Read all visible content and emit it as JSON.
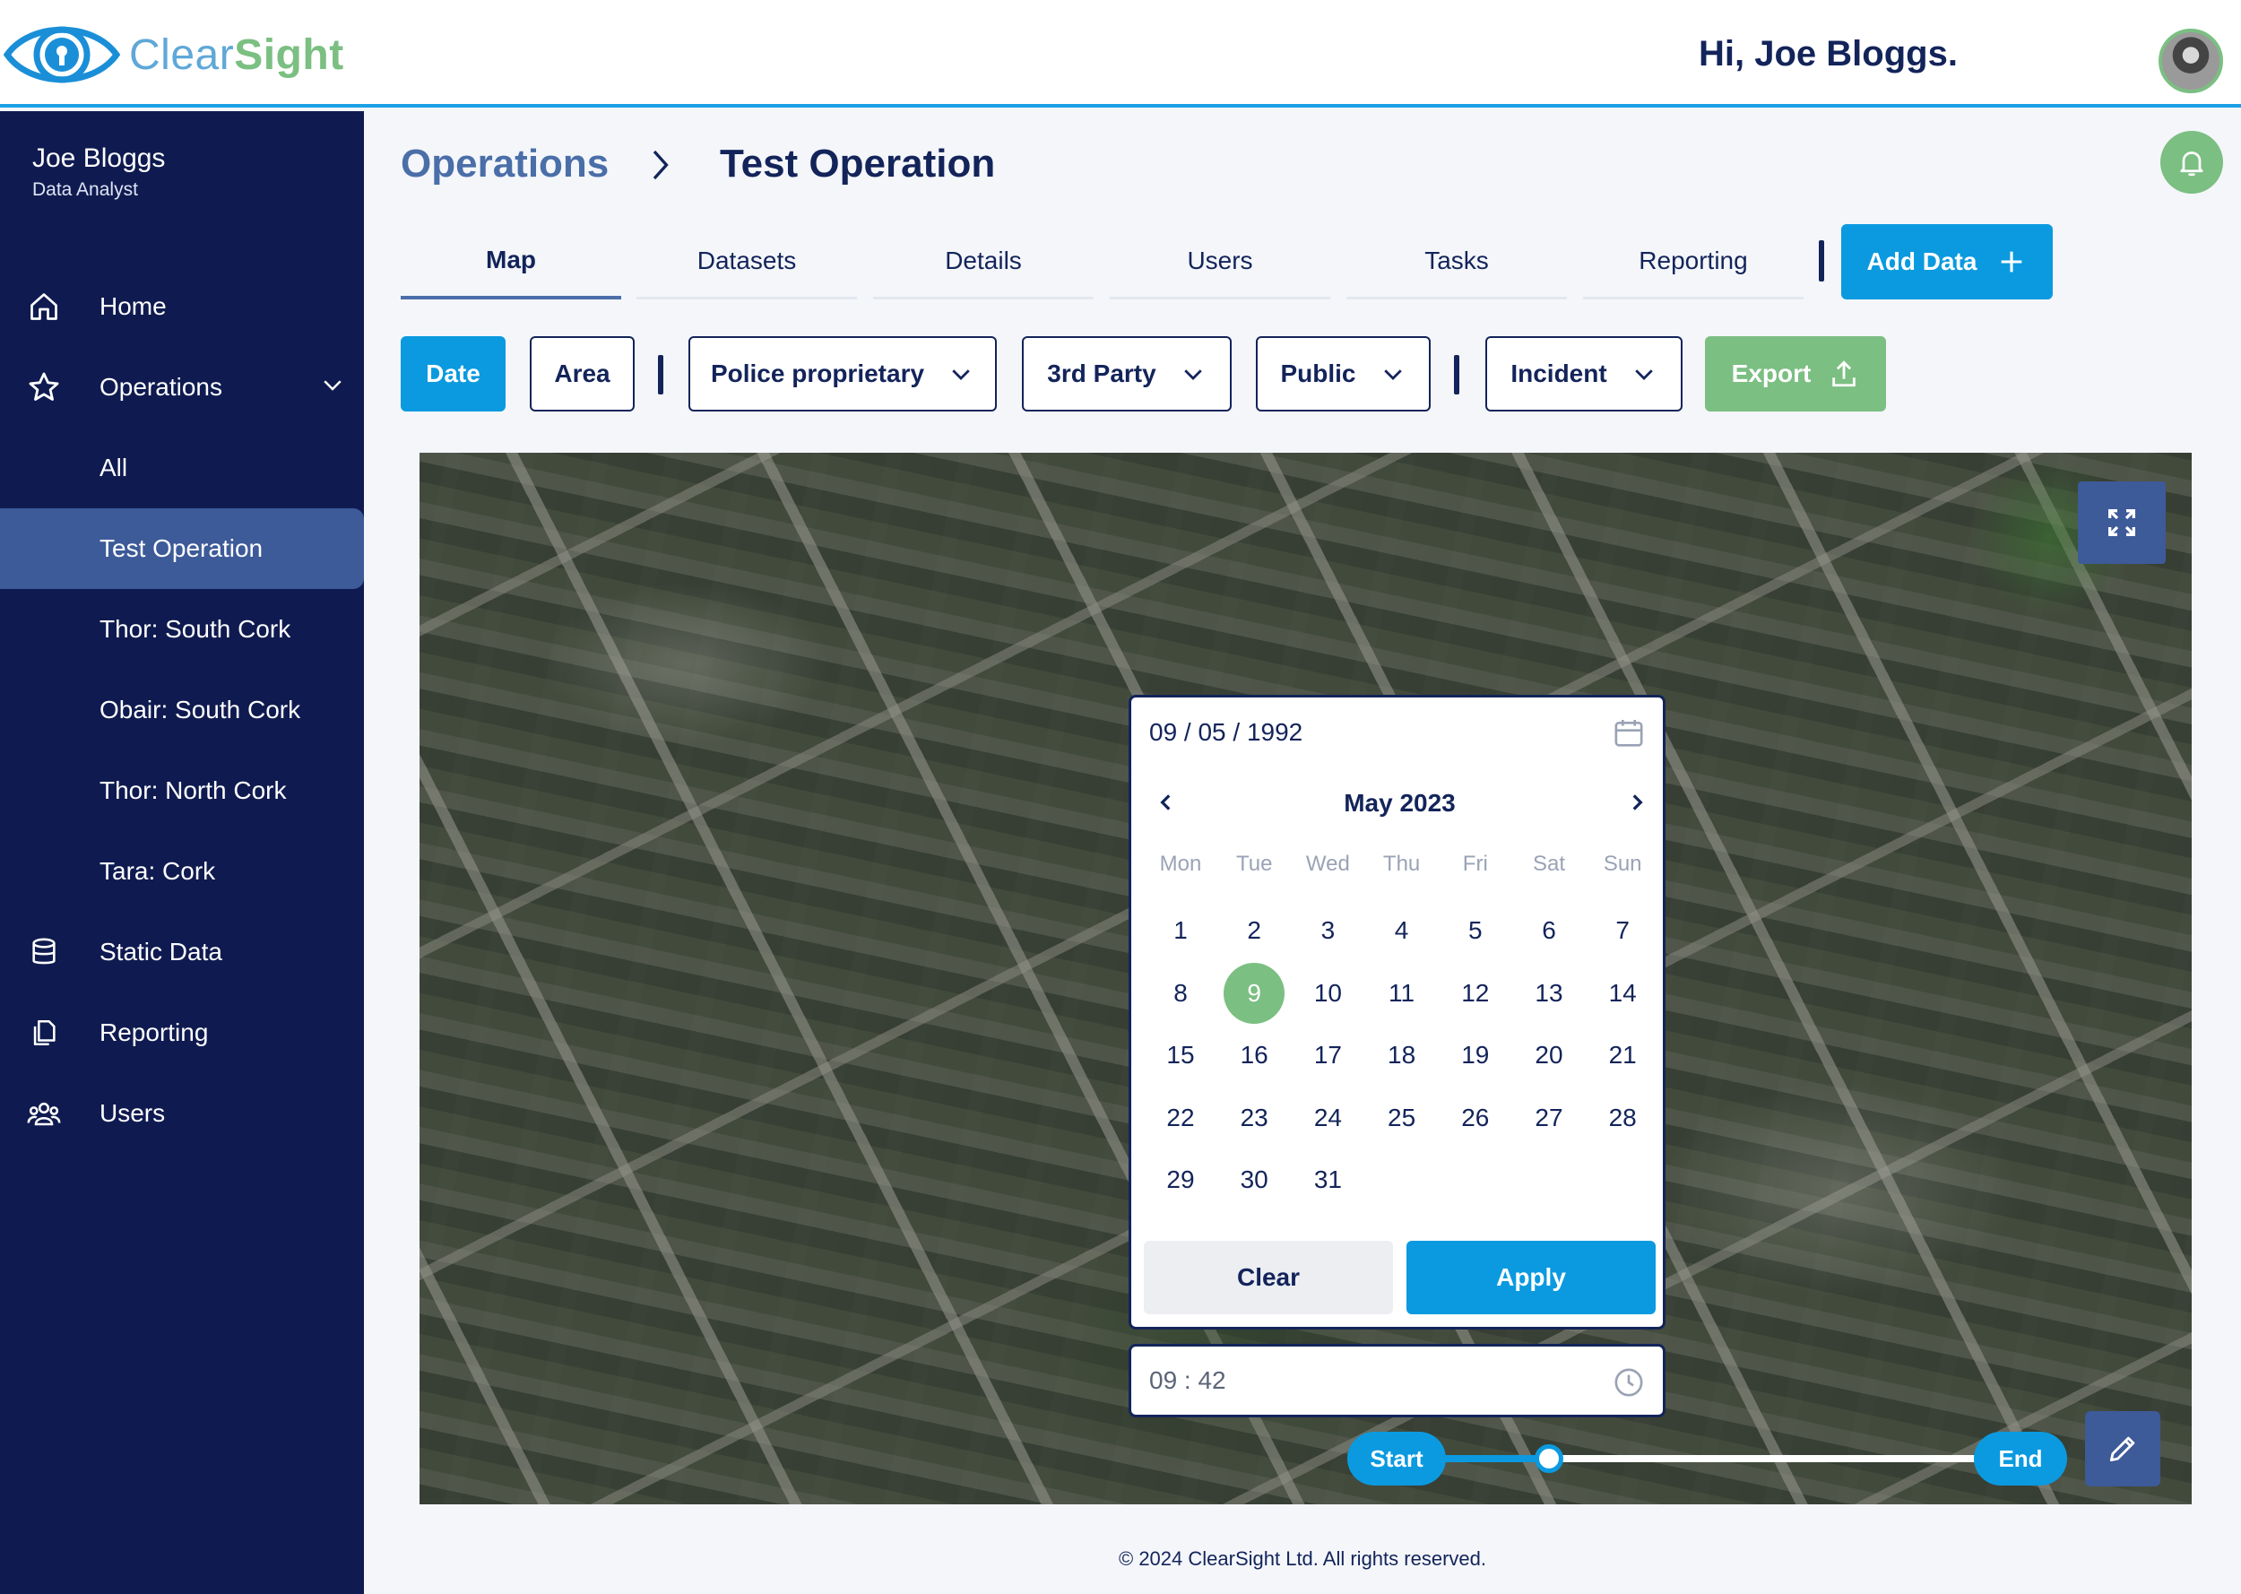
{
  "header": {
    "logo_part1": "Clear",
    "logo_part2": "Sight",
    "greeting": "Hi, Joe Bloggs."
  },
  "sidebar": {
    "user_name": "Joe Bloggs",
    "user_role": "Data Analyst",
    "items": [
      {
        "label": "Home",
        "icon": "home-icon"
      },
      {
        "label": "Operations",
        "icon": "star-icon"
      },
      {
        "label": "All"
      },
      {
        "label": "Test Operation",
        "active": true
      },
      {
        "label": "Thor: South Cork"
      },
      {
        "label": "Obair: South Cork"
      },
      {
        "label": "Thor: North Cork"
      },
      {
        "label": "Tara: Cork"
      },
      {
        "label": "Static Data",
        "icon": "database-icon"
      },
      {
        "label": "Reporting",
        "icon": "documents-icon"
      },
      {
        "label": "Users",
        "icon": "users-icon"
      }
    ]
  },
  "breadcrumb": {
    "parent": "Operations",
    "current": "Test Operation"
  },
  "tabs": [
    {
      "label": "Map",
      "active": true
    },
    {
      "label": "Datasets"
    },
    {
      "label": "Details"
    },
    {
      "label": "Users"
    },
    {
      "label": "Tasks"
    },
    {
      "label": "Reporting"
    }
  ],
  "add_data_label": "Add Data",
  "filters": {
    "date": "Date",
    "area": "Area",
    "police": "Police proprietary",
    "third_party": "3rd Party",
    "public": "Public",
    "incident": "Incident",
    "export": "Export"
  },
  "datepicker": {
    "date_value": "09 / 05 / 1992",
    "month_label": "May 2023",
    "weekdays": [
      "Mon",
      "Tue",
      "Wed",
      "Thu",
      "Fri",
      "Sat",
      "Sun"
    ],
    "days": [
      "1",
      "2",
      "3",
      "4",
      "5",
      "6",
      "7",
      "8",
      "9",
      "10",
      "11",
      "12",
      "13",
      "14",
      "15",
      "16",
      "17",
      "18",
      "19",
      "20",
      "21",
      "22",
      "23",
      "24",
      "25",
      "26",
      "27",
      "28",
      "29",
      "30",
      "31"
    ],
    "selected_day": "9",
    "clear_label": "Clear",
    "apply_label": "Apply",
    "time_value": "09 : 42"
  },
  "timeline": {
    "start_label": "Start",
    "end_label": "End",
    "position": 0.26
  },
  "colors": {
    "navy": "#0f1b50",
    "accent_blue": "#0b9ae0",
    "accent_green": "#7bbf82",
    "active_nav": "#3d5a99"
  },
  "footer": "© 2024 ClearSight Ltd. All rights reserved."
}
